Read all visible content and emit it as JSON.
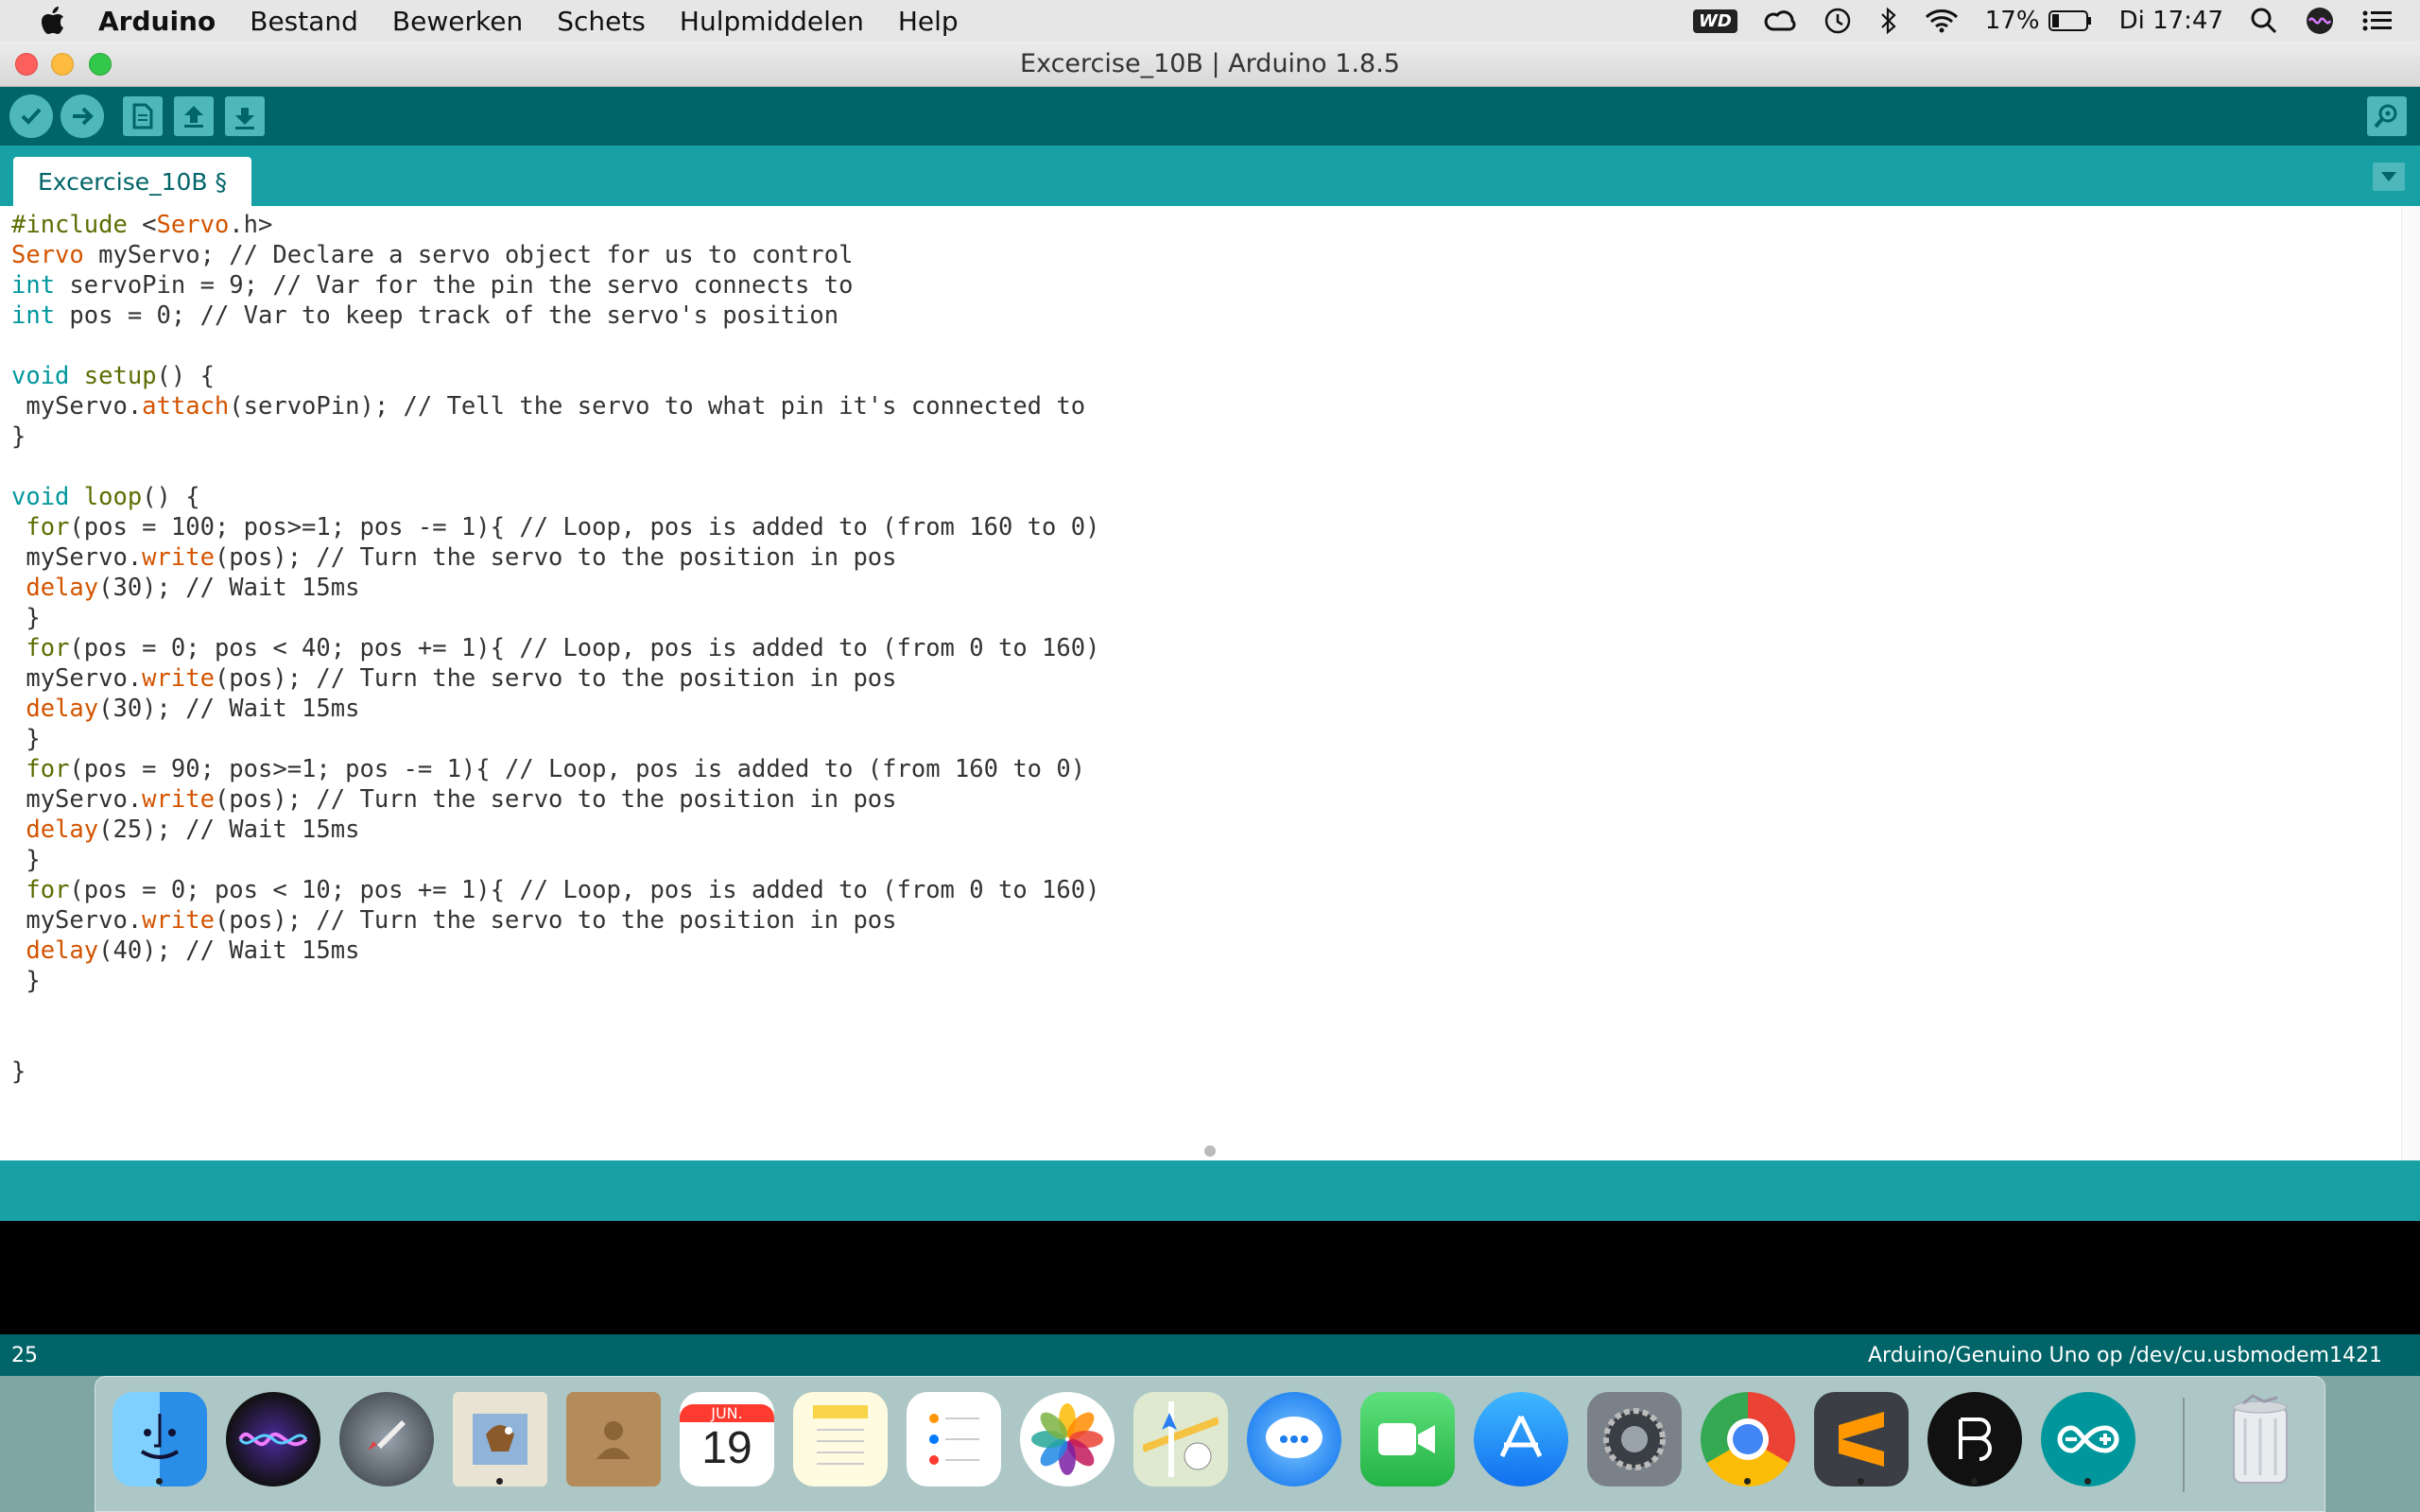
{
  "menubar": {
    "app_name": "Arduino",
    "items": [
      "Bestand",
      "Bewerken",
      "Schets",
      "Hulpmiddelen",
      "Help"
    ],
    "status": {
      "wd_label": "WD",
      "battery_percent": "17%",
      "clock": "Di 17:47"
    }
  },
  "window": {
    "title": "Excercise_10B | Arduino 1.8.5"
  },
  "tabs": {
    "active_label": "Excercise_10B §"
  },
  "status_bar": {
    "line_number": "25",
    "board_info": "Arduino/Genuino Uno op /dev/cu.usbmodem1421"
  },
  "dock": {
    "calendar_month": "JUN.",
    "calendar_day": "19"
  },
  "colors": {
    "toolbar": "#006468",
    "tabbar": "#17a1a5",
    "keyword": "#00979c",
    "function": "#d35400"
  },
  "code": [
    [
      {
        "t": "#include ",
        "c": "pp"
      },
      {
        "t": "<",
        "c": ""
      },
      {
        "t": "Servo",
        "c": "fn"
      },
      {
        "t": ".h>",
        "c": ""
      }
    ],
    [
      {
        "t": "Servo",
        "c": "fn"
      },
      {
        "t": " myServo; // Declare a servo object for us to control",
        "c": ""
      }
    ],
    [
      {
        "t": "int",
        "c": "kw"
      },
      {
        "t": " servoPin = 9; // Var for the pin the servo connects to",
        "c": ""
      }
    ],
    [
      {
        "t": "int",
        "c": "kw"
      },
      {
        "t": " pos = 0; // Var to keep track of the servo's position",
        "c": ""
      }
    ],
    [],
    [
      {
        "t": "void",
        "c": "kw"
      },
      {
        "t": " ",
        "c": ""
      },
      {
        "t": "setup",
        "c": "pp"
      },
      {
        "t": "() {",
        "c": ""
      }
    ],
    [
      {
        "t": " myServo.",
        "c": ""
      },
      {
        "t": "attach",
        "c": "fn"
      },
      {
        "t": "(servoPin); // Tell the servo to what pin it's connected to",
        "c": ""
      }
    ],
    [
      {
        "t": "}",
        "c": ""
      }
    ],
    [],
    [
      {
        "t": "void",
        "c": "kw"
      },
      {
        "t": " ",
        "c": ""
      },
      {
        "t": "loop",
        "c": "pp"
      },
      {
        "t": "() {",
        "c": ""
      }
    ],
    [
      {
        "t": " ",
        "c": ""
      },
      {
        "t": "for",
        "c": "pp"
      },
      {
        "t": "(pos = 100; pos>=1; pos -= 1){ // Loop, pos is added to (from 160 to 0)",
        "c": ""
      }
    ],
    [
      {
        "t": " myServo.",
        "c": ""
      },
      {
        "t": "write",
        "c": "fn"
      },
      {
        "t": "(pos); // Turn the servo to the position in pos",
        "c": ""
      }
    ],
    [
      {
        "t": " ",
        "c": ""
      },
      {
        "t": "delay",
        "c": "fn"
      },
      {
        "t": "(30); // Wait 15ms",
        "c": ""
      }
    ],
    [
      {
        "t": " }",
        "c": ""
      }
    ],
    [
      {
        "t": " ",
        "c": ""
      },
      {
        "t": "for",
        "c": "pp"
      },
      {
        "t": "(pos = 0; pos < 40; pos += 1){ // Loop, pos is added to (from 0 to 160)",
        "c": ""
      }
    ],
    [
      {
        "t": " myServo.",
        "c": ""
      },
      {
        "t": "write",
        "c": "fn"
      },
      {
        "t": "(pos); // Turn the servo to the position in pos",
        "c": ""
      }
    ],
    [
      {
        "t": " ",
        "c": ""
      },
      {
        "t": "delay",
        "c": "fn"
      },
      {
        "t": "(30); // Wait 15ms",
        "c": ""
      }
    ],
    [
      {
        "t": " }",
        "c": ""
      }
    ],
    [
      {
        "t": " ",
        "c": ""
      },
      {
        "t": "for",
        "c": "pp"
      },
      {
        "t": "(pos = 90; pos>=1; pos -= 1){ // Loop, pos is added to (from 160 to 0)",
        "c": ""
      }
    ],
    [
      {
        "t": " myServo.",
        "c": ""
      },
      {
        "t": "write",
        "c": "fn"
      },
      {
        "t": "(pos); // Turn the servo to the position in pos",
        "c": ""
      }
    ],
    [
      {
        "t": " ",
        "c": ""
      },
      {
        "t": "delay",
        "c": "fn"
      },
      {
        "t": "(25); // Wait 15ms",
        "c": ""
      }
    ],
    [
      {
        "t": " }",
        "c": ""
      }
    ],
    [
      {
        "t": " ",
        "c": ""
      },
      {
        "t": "for",
        "c": "pp"
      },
      {
        "t": "(pos = 0; pos < 10; pos += 1){ // Loop, pos is added to (from 0 to 160)",
        "c": ""
      }
    ],
    [
      {
        "t": " myServo.",
        "c": ""
      },
      {
        "t": "write",
        "c": "fn"
      },
      {
        "t": "(pos); // Turn the servo to the position in pos",
        "c": ""
      }
    ],
    [
      {
        "t": " ",
        "c": ""
      },
      {
        "t": "delay",
        "c": "fn"
      },
      {
        "t": "(40); // Wait 15ms",
        "c": ""
      }
    ],
    [
      {
        "t": " }",
        "c": ""
      }
    ],
    [],
    [],
    [
      {
        "t": "}",
        "c": ""
      }
    ]
  ]
}
